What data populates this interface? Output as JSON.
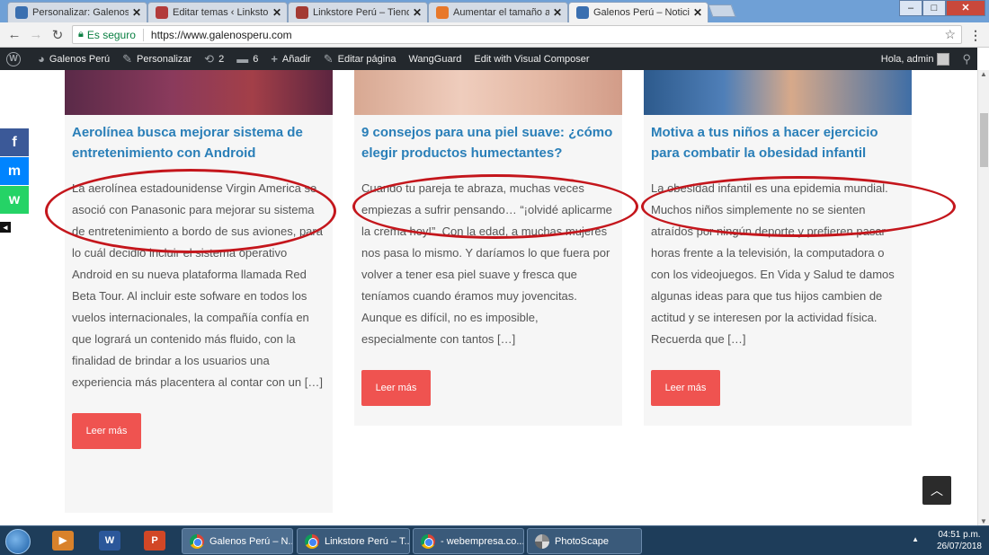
{
  "browser": {
    "tabs": [
      {
        "title": "Personalizar: Galenos Pe",
        "favicon_color": "#3a6fb0",
        "active": false
      },
      {
        "title": "Editar temas ‹ Linkstore P",
        "favicon_color": "#b23b3b",
        "active": false
      },
      {
        "title": "Linkstore Perú – Tienda O",
        "favicon_color": "#a33a33",
        "active": false
      },
      {
        "title": "Aumentar el tamaño a un",
        "favicon_color": "#e8782a",
        "active": false
      },
      {
        "title": "Galenos Perú – Noticias y",
        "favicon_color": "#3a6fb0",
        "active": true
      }
    ],
    "close_glyph": "✕",
    "window_controls": {
      "minimize": "–",
      "maximize": "□",
      "close": "✕"
    },
    "address": {
      "secure_label": "Es seguro",
      "url": "https://www.galenosperu.com"
    }
  },
  "adminbar": {
    "wp_logo": "W",
    "site_name": "Galenos Perú",
    "customize": "Personalizar",
    "updates_count": "2",
    "comments_count": "6",
    "add_new": "Añadir",
    "edit_page": "Editar página",
    "wangguard": "WangGuard",
    "visual_composer": "Edit with Visual Composer",
    "greeting": "Hola, admin"
  },
  "posts": [
    {
      "title": "Aerolínea busca mejorar sistema de entretenimiento con Android",
      "excerpt": "La aerolínea estadounidense Virgin America se asoció con Panasonic para mejorar su sistema de entretenimiento a bordo de sus aviones, para lo cuál decidió incluir el sistema operativo Android en su nueva plataforma llamada Red Beta Tour. Al incluir este sofware en todos los vuelos internacionales, la compañía confía en que logrará un contenido más fluido, con la finalidad de brindar a los usuarios una experiencia más placentera al contar con un […]",
      "button": "Leer más",
      "image_color": "#6a2f4f"
    },
    {
      "title": "9 consejos para una piel suave: ¿cómo elegir productos humectantes?",
      "excerpt": "Cuando tu pareja te abraza, muchas veces empiezas a sufrir pensando… “¡olvidé aplicarme la crema hoy!”. Con la edad, a muchas mujeres nos pasa lo mismo. Y daríamos lo que fuera por volver a tener esa piel suave y fresca que teníamos cuando éramos muy jovencitas. Aunque es difícil, no es imposible, especialmente con tantos […]",
      "button": "Leer más",
      "image_color": "#e2b9a4"
    },
    {
      "title": "Motiva a tus niños a hacer ejercicio para combatir la obesidad infantil",
      "excerpt": "La obesidad infantil es una epidemia mundial. Muchos niños simplemente no se sienten atraídos por ningún deporte y prefieren pasar horas frente a la televisión, la computadora o con los videojuegos. En Vida y Salud te damos algunas ideas para que tus hijos cambien de actitud y se interesen por la actividad física. Recuerda que […]",
      "button": "Leer más",
      "image_color": "#3f6ea6"
    }
  ],
  "share": {
    "facebook": "f",
    "messenger": "m",
    "whatsapp": "w",
    "hide": "◂"
  },
  "back_to_top": "︿",
  "annotation_color": "#c4161c",
  "taskbar": {
    "pinned": [
      {
        "name": "media-player",
        "label": "▶",
        "color": "#d9822b"
      },
      {
        "name": "word",
        "label": "W",
        "color": "#2b579a"
      },
      {
        "name": "powerpoint",
        "label": "P",
        "color": "#d24726"
      }
    ],
    "tasks": [
      {
        "label": "Galenos Perú – N..."
      },
      {
        "label": "Linkstore Perú – T..."
      },
      {
        "label": "- webempresa.co..."
      },
      {
        "label": "PhotoScape"
      }
    ],
    "time": "04:51 p.m.",
    "date": "26/07/2018"
  }
}
